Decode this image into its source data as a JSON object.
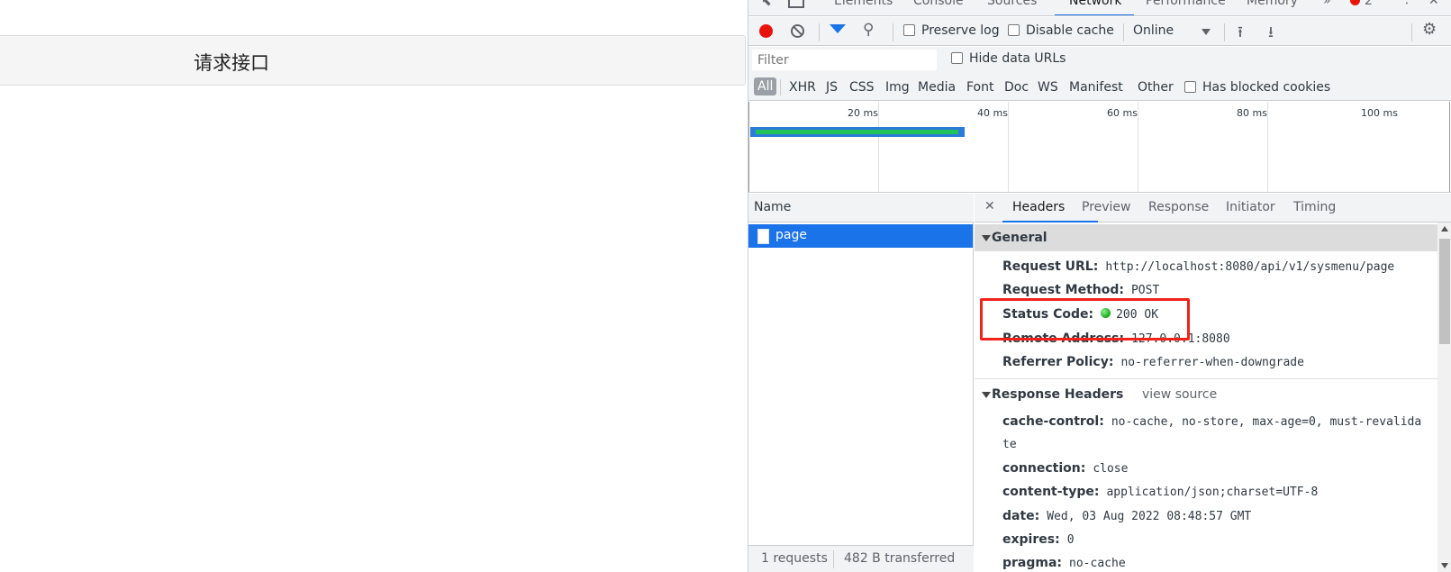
{
  "page": {
    "request_button": "请求接口"
  },
  "devtools": {
    "main_tabs": [
      "Elements",
      "Console",
      "Sources",
      "Network",
      "Performance",
      "Memory"
    ],
    "error_count": "2",
    "toolbar": {
      "preserve_log": "Preserve log",
      "disable_cache": "Disable cache",
      "throttling": "Online"
    },
    "filter": {
      "placeholder": "Filter",
      "hide_data_urls": "Hide data URLs"
    },
    "types": [
      "All",
      "XHR",
      "JS",
      "CSS",
      "Img",
      "Media",
      "Font",
      "Doc",
      "WS",
      "Manifest",
      "Other"
    ],
    "has_blocked_cookies": "Has blocked cookies",
    "overview_ticks": [
      "20 ms",
      "40 ms",
      "60 ms",
      "80 ms",
      "100 ms"
    ],
    "name_header": "Name",
    "requests": [
      {
        "name": "page"
      }
    ],
    "status": {
      "requests": "1 requests",
      "transferred": "482 B transferred"
    },
    "detail_tabs": [
      "Headers",
      "Preview",
      "Response",
      "Initiator",
      "Timing"
    ],
    "general": {
      "title": "General",
      "rows": [
        {
          "key": "Request URL:",
          "value": "http://localhost:8080/api/v1/sysmenu/page"
        },
        {
          "key": "Request Method:",
          "value": "POST"
        },
        {
          "key": "Status Code:",
          "value": "200 OK"
        },
        {
          "key": "Remote Address:",
          "value": "127.0.0.1:8080"
        },
        {
          "key": "Referrer Policy:",
          "value": "no-referrer-when-downgrade"
        }
      ]
    },
    "response_headers": {
      "title": "Response Headers",
      "view_source": "view source",
      "rows": [
        {
          "key": "cache-control:",
          "value": "no-cache, no-store, max-age=0, must-revalida",
          "wrap": "te"
        },
        {
          "key": "connection:",
          "value": "close"
        },
        {
          "key": "content-type:",
          "value": "application/json;charset=UTF-8"
        },
        {
          "key": "date:",
          "value": "Wed, 03 Aug 2022 08:48:57 GMT"
        },
        {
          "key": "expires:",
          "value": "0"
        },
        {
          "key": "pragma:",
          "value": "no-cache"
        }
      ]
    },
    "colors": {
      "accent": "#1a73e8",
      "highlight": "#f0221a",
      "record": "#e8140c",
      "status_ok": "#14a514"
    }
  }
}
